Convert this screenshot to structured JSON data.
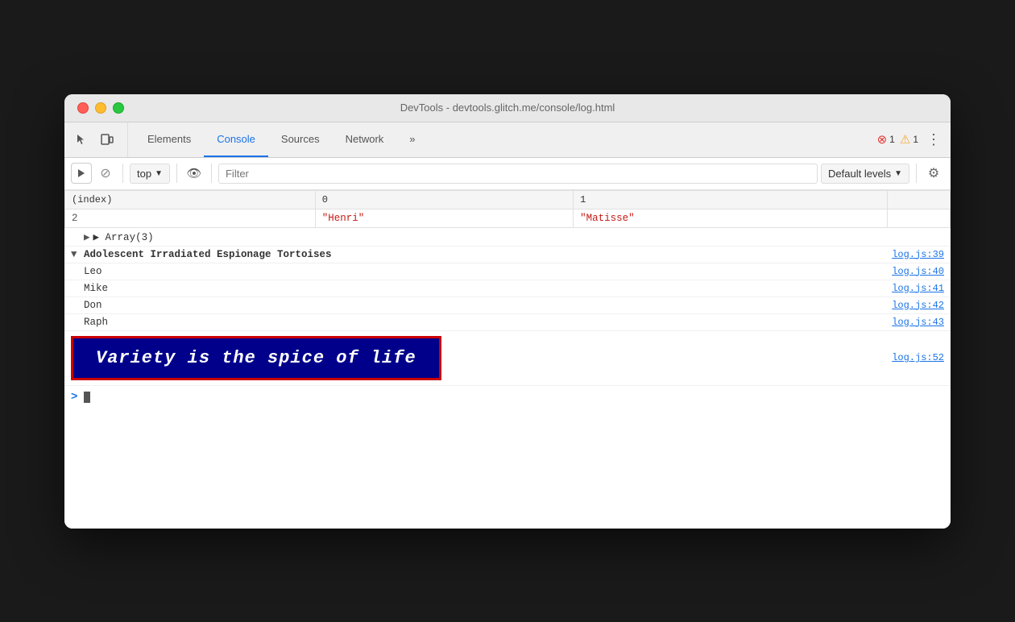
{
  "window": {
    "title": "DevTools - devtools.glitch.me/console/log.html"
  },
  "tabs": {
    "items": [
      {
        "id": "elements",
        "label": "Elements",
        "active": false
      },
      {
        "id": "console",
        "label": "Console",
        "active": true
      },
      {
        "id": "sources",
        "label": "Sources",
        "active": false
      },
      {
        "id": "network",
        "label": "Network",
        "active": false
      },
      {
        "id": "more",
        "label": "»",
        "active": false
      }
    ]
  },
  "badges": {
    "errors": "1",
    "warnings": "1"
  },
  "toolbar": {
    "context": "top",
    "filter_placeholder": "Filter",
    "levels": "Default levels"
  },
  "table": {
    "headers": [
      "(index)",
      "0",
      "1"
    ],
    "row": {
      "index": "2",
      "col0": "\"Henri\"",
      "col1": "\"Matisse\""
    }
  },
  "array_label": "▶ Array(3)",
  "log_entries": [
    {
      "id": "adolescent",
      "indent": false,
      "expand": "▼",
      "text": "Adolescent Irradiated Espionage Tortoises",
      "bold": true,
      "link": "log.js:39"
    },
    {
      "id": "leo",
      "indent": true,
      "text": "Leo",
      "link": "log.js:40"
    },
    {
      "id": "mike",
      "indent": true,
      "text": "Mike",
      "link": "log.js:41"
    },
    {
      "id": "don",
      "indent": true,
      "text": "Don",
      "link": "log.js:42"
    },
    {
      "id": "raph",
      "indent": true,
      "text": "Raph",
      "link": "log.js:43"
    }
  ],
  "variety": {
    "text": "Variety is the spice of life",
    "link": "log.js:52"
  },
  "prompt_arrow": ">"
}
